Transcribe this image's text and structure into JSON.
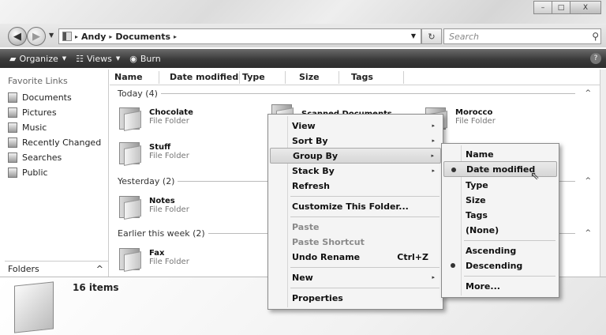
{
  "window": {
    "min_glyph": "–",
    "max_glyph": "□",
    "close_glyph": "X"
  },
  "address": {
    "back_glyph": "◀",
    "forward_glyph": "▶",
    "breadcrumbs": [
      "Andy",
      "Documents"
    ],
    "crumb_sep": "▸",
    "refresh_glyph": "↻",
    "search_placeholder": "Search",
    "search_icon": "⚲",
    "drop_glyph": "▼"
  },
  "toolbar": {
    "organize": "Organize",
    "views": "Views",
    "burn": "Burn",
    "caret": "▼",
    "help": "?",
    "organize_icon": "▰",
    "views_icon": "☷",
    "burn_icon": "◉"
  },
  "nav": {
    "title": "Favorite Links",
    "items": [
      "Documents",
      "Pictures",
      "Music",
      "Recently Changed",
      "Searches",
      "Public"
    ],
    "folders_label": "Folders",
    "folders_toggle": "^"
  },
  "columns": [
    "Name",
    "Date modified",
    "Type",
    "Size",
    "Tags"
  ],
  "groups": [
    {
      "label": "Today (4)",
      "toggle": "^"
    },
    {
      "label": "Yesterday (2)",
      "toggle": "^"
    },
    {
      "label": "Earlier this week (2)",
      "toggle": "^"
    }
  ],
  "files": [
    {
      "name": "Chocolate",
      "type": "File Folder"
    },
    {
      "name": "Scanned Documents",
      "type": ""
    },
    {
      "name": "Morocco",
      "type": "File Folder"
    },
    {
      "name": "Stuff",
      "type": "File Folder"
    },
    {
      "name": "Notes",
      "type": "File Folder"
    },
    {
      "name": "Fax",
      "type": "File Folder"
    }
  ],
  "details": {
    "count": "16 items"
  },
  "context_menu": {
    "items": [
      {
        "label": "View",
        "submenu": true
      },
      {
        "label": "Sort By",
        "submenu": true
      },
      {
        "label": "Group By",
        "submenu": true,
        "highlighted": true
      },
      {
        "label": "Stack By",
        "submenu": true
      },
      {
        "label": "Refresh"
      },
      {
        "label": "Customize This Folder..."
      },
      {
        "label": "Paste",
        "disabled": true
      },
      {
        "label": "Paste Shortcut",
        "disabled": true
      },
      {
        "label": "Undo Rename",
        "shortcut": "Ctrl+Z"
      },
      {
        "label": "New",
        "submenu": true
      },
      {
        "label": "Properties"
      }
    ],
    "submenu_arrow": "▸"
  },
  "group_by_menu": {
    "items": [
      {
        "label": "Name"
      },
      {
        "label": "Date modified",
        "selected": true,
        "highlighted": true
      },
      {
        "label": "Type"
      },
      {
        "label": "Size"
      },
      {
        "label": "Tags"
      },
      {
        "label": "(None)"
      },
      {
        "label": "Ascending"
      },
      {
        "label": "Descending",
        "selected": true
      },
      {
        "label": "More..."
      }
    ]
  },
  "cursor_glyph": "⇖"
}
